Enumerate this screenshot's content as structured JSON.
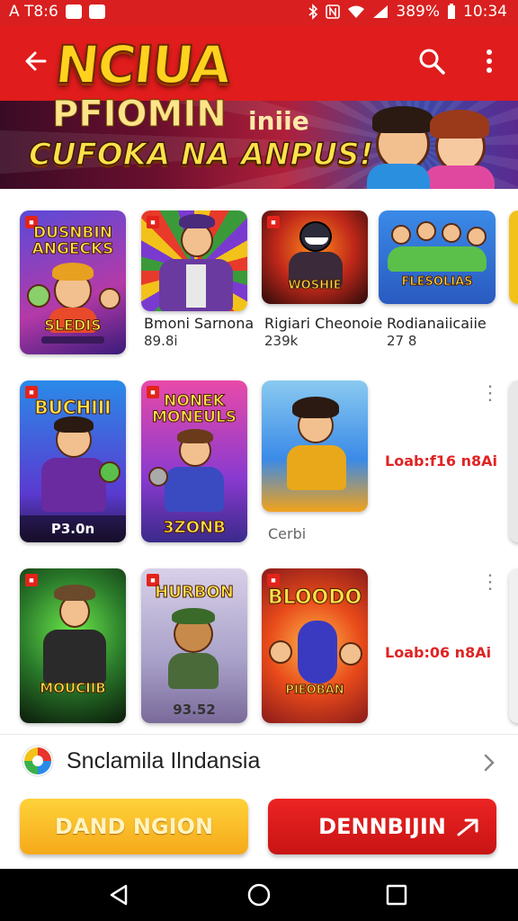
{
  "status_bar": {
    "left_text": "A T8:6",
    "battery_percent": "389%",
    "time": "10:34"
  },
  "header": {
    "title_main": "NCIUA",
    "title_second_a": "PFIOMIN",
    "title_second_b": "iniie",
    "title_sub": "CUFOKA NA ANPUS!"
  },
  "cards": {
    "row1": [
      {
        "cap_top": "DUSNBIN ANGECKS",
        "cap_bottom": "SLEDIS",
        "foot": ""
      },
      {
        "title": "Bmoni Sarnona",
        "count": "89.8i"
      },
      {
        "title": "Rigiari Cheonoie",
        "count": "239k",
        "art_text": "WOSHIE"
      },
      {
        "title": "Rodianaiicaiie",
        "count": "27 8",
        "art_text": "FLESOLIAS"
      }
    ],
    "row2": [
      {
        "cap_top": "BUCHIII",
        "foot": "P3.0n"
      },
      {
        "cap_top": "NONEK MONEULS",
        "foot": "3ZONB"
      },
      {
        "title": "Cerbi"
      },
      {
        "red_text": "Loab:f16 n8Ai"
      }
    ],
    "row3": [
      {
        "cap_top": "MOUCIIB"
      },
      {
        "cap_top": "HURBON",
        "foot": "93.52"
      },
      {
        "cap_top": "BLOODO",
        "cap_bottom": "PIEOBAN"
      },
      {
        "red_text": "Loab:06 n8Ai"
      }
    ]
  },
  "store": {
    "name": "Snclamila Ilndansia"
  },
  "buttons": {
    "yellow_label": "DAND NGION",
    "red_label": "DENNBIJIN"
  },
  "colors": {
    "brand_red": "#e01c1c",
    "accent_yellow": "#f5a91a"
  },
  "icons": [
    "back-arrow-icon",
    "search-icon",
    "more-vert-icon",
    "chevron-right-icon",
    "nav-back-icon",
    "nav-home-icon",
    "nav-recents-icon",
    "external-arrow-icon"
  ]
}
